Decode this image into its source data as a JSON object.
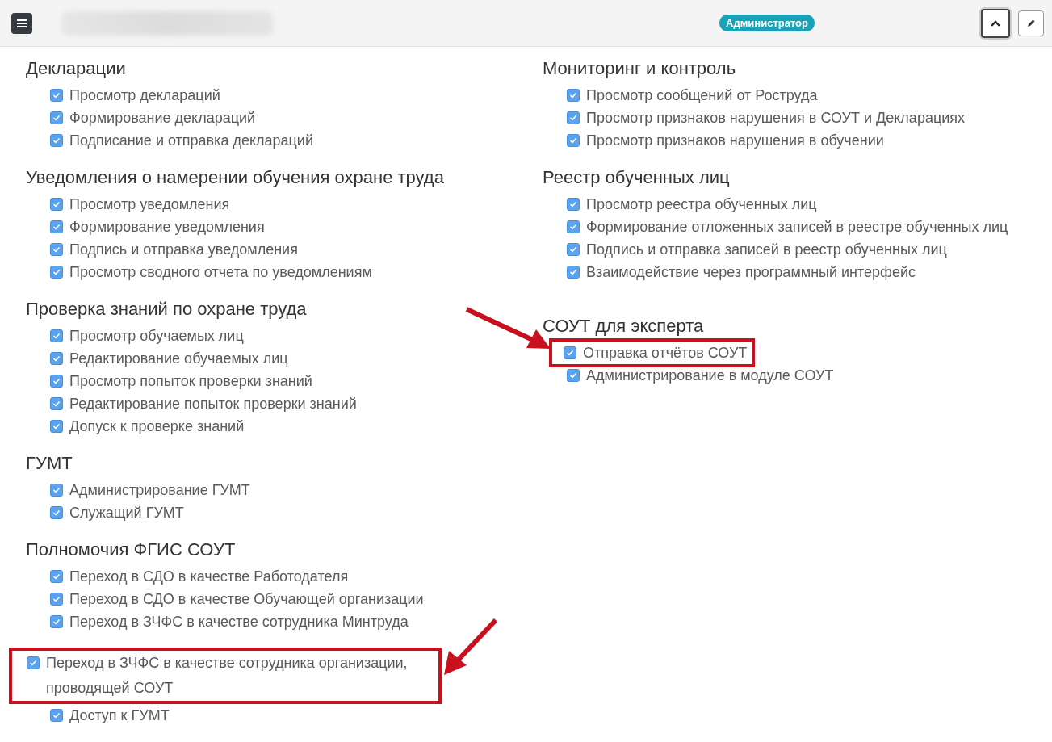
{
  "topbar": {
    "role_badge": "Администратор",
    "collapse_pressed": true
  },
  "columns": [
    {
      "groups": [
        {
          "title": "Декларации",
          "items": [
            {
              "label": "Просмотр деклараций",
              "checked": true,
              "highlighted": false,
              "kind": "normal"
            },
            {
              "label": "Формирование деклараций",
              "checked": true,
              "highlighted": false,
              "kind": "normal"
            },
            {
              "label": "Подписание и отправка деклараций",
              "checked": true,
              "highlighted": false,
              "kind": "normal"
            }
          ]
        },
        {
          "title": "Уведомления о намерении обучения охране труда",
          "items": [
            {
              "label": "Просмотр уведомления",
              "checked": true,
              "highlighted": false,
              "kind": "normal"
            },
            {
              "label": "Формирование уведомления",
              "checked": true,
              "highlighted": false,
              "kind": "normal"
            },
            {
              "label": "Подпись и отправка уведомления",
              "checked": true,
              "highlighted": false,
              "kind": "normal"
            },
            {
              "label": "Просмотр сводного отчета по уведомлениям",
              "checked": true,
              "highlighted": false,
              "kind": "normal"
            }
          ]
        },
        {
          "title": "Проверка знаний по охране труда",
          "items": [
            {
              "label": "Просмотр обучаемых лиц",
              "checked": true,
              "highlighted": false,
              "kind": "normal"
            },
            {
              "label": "Редактирование обучаемых лиц",
              "checked": true,
              "highlighted": false,
              "kind": "normal"
            },
            {
              "label": "Просмотр попыток проверки знаний",
              "checked": true,
              "highlighted": false,
              "kind": "normal"
            },
            {
              "label": "Редактирование попыток проверки знаний",
              "checked": true,
              "highlighted": false,
              "kind": "normal"
            },
            {
              "label": "Допуск к проверке знаний",
              "checked": true,
              "highlighted": false,
              "kind": "normal"
            }
          ]
        },
        {
          "title": "ГУМТ",
          "items": [
            {
              "label": "Администрирование ГУМТ",
              "checked": true,
              "highlighted": false,
              "kind": "normal"
            },
            {
              "label": "Служащий ГУМТ",
              "checked": true,
              "highlighted": false,
              "kind": "normal"
            }
          ]
        },
        {
          "title": "Полномочия ФГИС СОУТ",
          "items": [
            {
              "label": "Переход в СДО в качестве Работодателя",
              "checked": true,
              "highlighted": false,
              "kind": "normal"
            },
            {
              "label": "Переход в СДО в качестве Обучающей организации",
              "checked": true,
              "highlighted": false,
              "kind": "normal"
            },
            {
              "label": "Переход в ЗЧФС в качестве сотрудника Минтруда",
              "checked": true,
              "highlighted": false,
              "kind": "normal"
            },
            {
              "label": "Переход в ЗЧФС в качестве сотрудника организации, проводящей СОУТ",
              "checked": true,
              "highlighted": true,
              "kind": "outdented"
            },
            {
              "label": "Доступ к ГУМТ",
              "checked": true,
              "highlighted": false,
              "kind": "normal"
            }
          ]
        }
      ]
    },
    {
      "groups": [
        {
          "title": "Мониторинг и контроль",
          "items": [
            {
              "label": "Просмотр сообщений от Роструда",
              "checked": true,
              "highlighted": false,
              "kind": "normal"
            },
            {
              "label": "Просмотр признаков нарушения в СОУТ и Декларациях",
              "checked": true,
              "highlighted": false,
              "kind": "normal"
            },
            {
              "label": "Просмотр признаков нарушения в обучении",
              "checked": true,
              "highlighted": false,
              "kind": "normal"
            }
          ]
        },
        {
          "title": "Реестр обученных лиц",
          "items": [
            {
              "label": "Просмотр реестра обученных лиц",
              "checked": true,
              "highlighted": false,
              "kind": "normal"
            },
            {
              "label": "Формирование отложенных записей в реестре обученных лиц",
              "checked": true,
              "highlighted": false,
              "kind": "normal"
            },
            {
              "label": "Подпись и отправка записей в реестр обученных лиц",
              "checked": true,
              "highlighted": false,
              "kind": "normal"
            },
            {
              "label": "Взаимодействие через программный интерфейс",
              "checked": true,
              "highlighted": false,
              "kind": "normal"
            }
          ]
        },
        {
          "title": "СОУТ для эксперта",
          "items": [
            {
              "label": "Отправка отчётов СОУТ",
              "checked": true,
              "highlighted": true,
              "kind": "normal"
            },
            {
              "label": "Администрирование в модуле СОУТ",
              "checked": true,
              "highlighted": false,
              "kind": "normal"
            }
          ]
        }
      ]
    }
  ]
}
